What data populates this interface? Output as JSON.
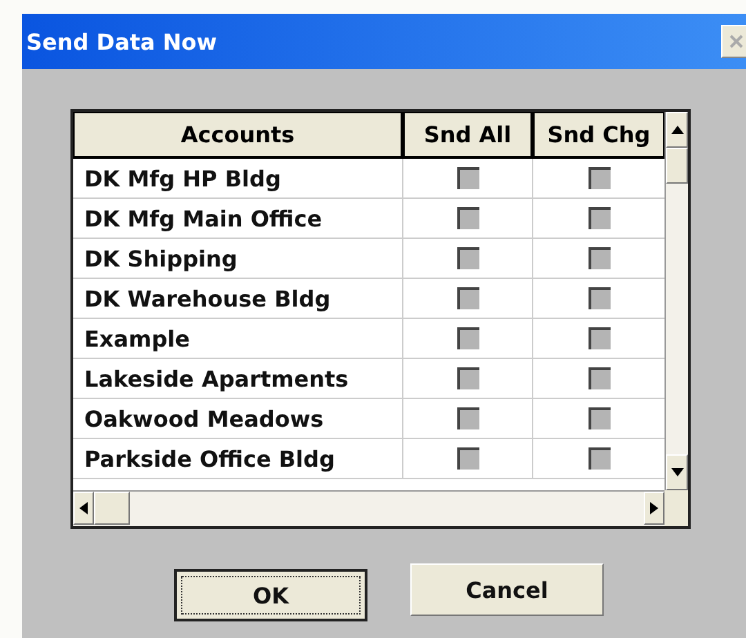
{
  "window": {
    "title": "Send Data Now"
  },
  "table": {
    "columns": [
      "Accounts",
      "Snd All",
      "Snd Chg"
    ],
    "rows": [
      {
        "account": "DK Mfg HP Bldg",
        "snd_all": false,
        "snd_chg": false
      },
      {
        "account": "DK Mfg Main Office",
        "snd_all": false,
        "snd_chg": false
      },
      {
        "account": "DK Shipping",
        "snd_all": false,
        "snd_chg": false
      },
      {
        "account": "DK Warehouse Bldg",
        "snd_all": false,
        "snd_chg": false
      },
      {
        "account": "Example",
        "snd_all": false,
        "snd_chg": false
      },
      {
        "account": "Lakeside Apartments",
        "snd_all": false,
        "snd_chg": false
      },
      {
        "account": "Oakwood Meadows",
        "snd_all": false,
        "snd_chg": false
      },
      {
        "account": "Parkside Office Bldg",
        "snd_all": false,
        "snd_chg": false
      }
    ]
  },
  "buttons": [
    {
      "label": "OK",
      "focused": true
    },
    {
      "label": "Cancel",
      "focused": false
    }
  ]
}
